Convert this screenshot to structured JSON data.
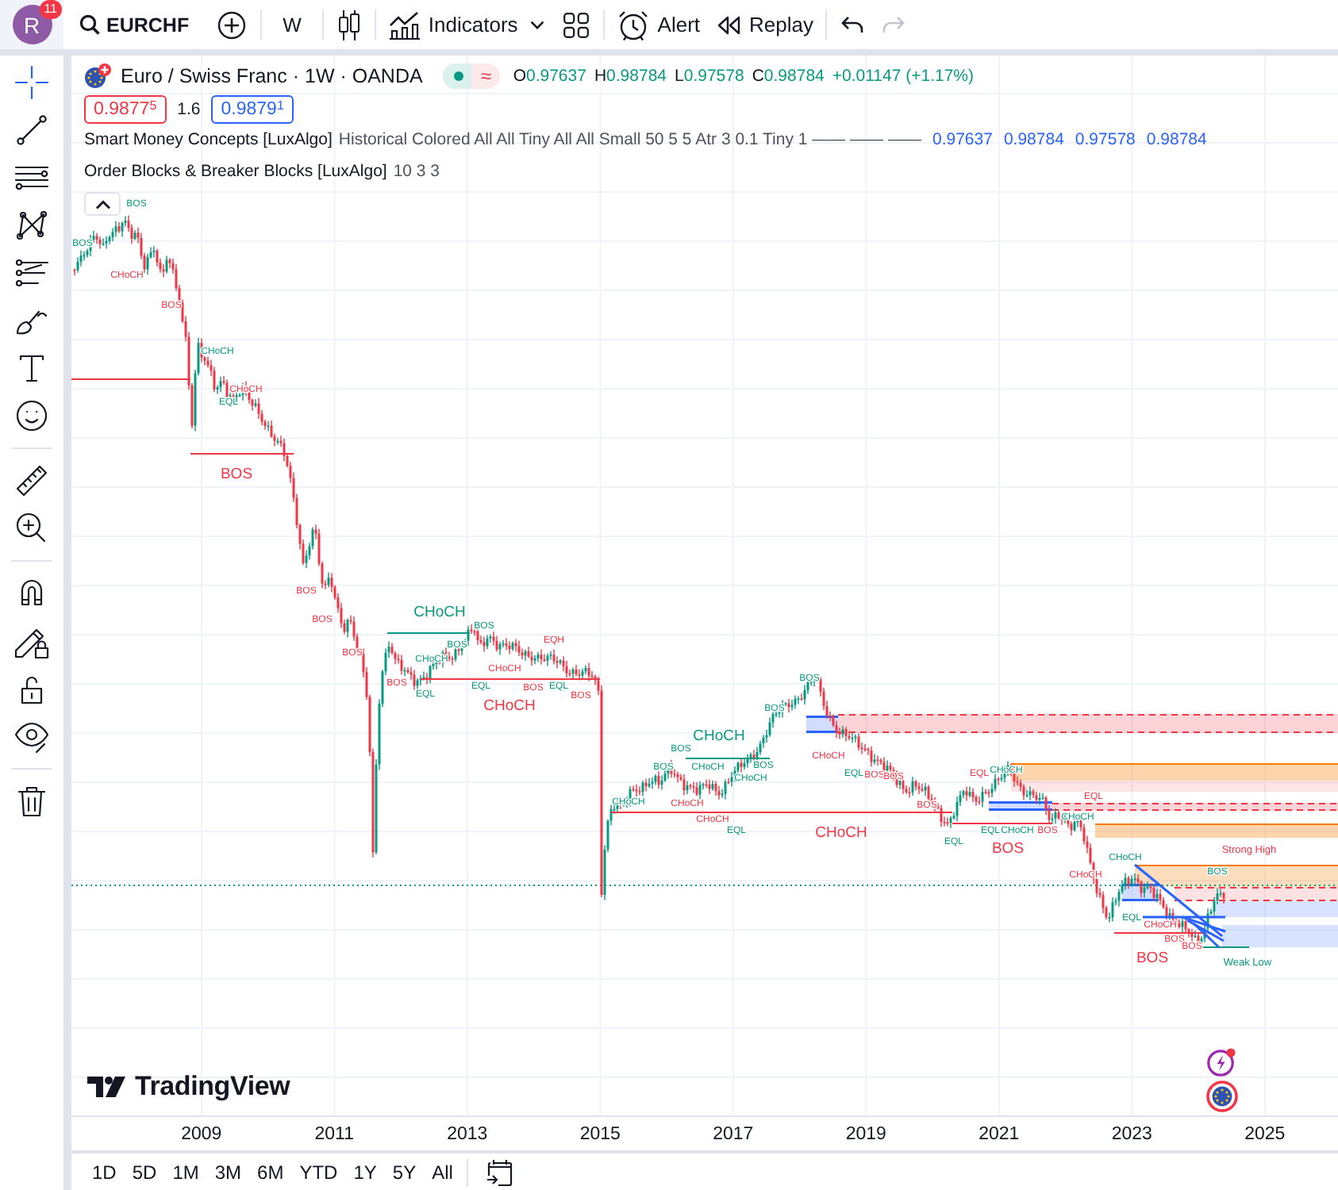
{
  "top_toolbar": {
    "avatar": {
      "initial": "R",
      "badge": "11"
    },
    "symbol": "EURCHF",
    "interval": "W",
    "indicators_button": "Indicators",
    "alert_button": "Alert",
    "replay_button": "Replay",
    "undo": {
      "disabled": false
    },
    "redo": {
      "disabled": true
    }
  },
  "drawing_toolbar": {
    "groups": [
      {
        "tools": [
          {
            "selected": true
          },
          {
            "selected": false
          },
          {
            "selected": false
          },
          {
            "selected": false
          },
          {
            "selected": false
          },
          {
            "selected": false
          },
          {
            "selected": false
          },
          {
            "selected": false
          }
        ]
      },
      {
        "tools": [
          {
            "selected": false
          },
          {
            "selected": false
          }
        ]
      },
      {
        "tools": [
          {
            "selected": false
          },
          {
            "selected": false
          },
          {
            "selected": false
          },
          {
            "selected": false
          }
        ]
      },
      {
        "tools": [
          {
            "selected": false
          }
        ]
      }
    ]
  },
  "legend": {
    "title": "Euro / Swiss Franc · 1W · OANDA",
    "market_badge": {
      "open": true,
      "symbol": "≈"
    },
    "ohlc": [
      {
        "label": "O",
        "value": "0.97637"
      },
      {
        "label": "H",
        "value": "0.98784"
      },
      {
        "label": "L",
        "value": "0.97578"
      },
      {
        "label": "C",
        "value": "0.98784"
      }
    ],
    "change": "+0.01147 (+1.17%)",
    "bid": "0.9877$^{5}$",
    "spread": "1.6",
    "ask": "0.9879$^{1}$"
  },
  "indicators": [
    {
      "name": "Smart Money Concepts [LuxAlgo]",
      "inputs": "Historical Colored All All Tiny All All Small 50 5 5 Atr 3 0.1 Tiny 1 —— —— ——",
      "values": [
        "0.97637",
        "0.98784",
        "0.97578",
        "0.98784"
      ]
    },
    {
      "name": "Order Blocks & Breaker Blocks [LuxAlgo]",
      "inputs": "10 3 3"
    }
  ],
  "chart": {
    "annotations": [
      {
        "text": "BOS",
        "color": "#089981",
        "kind": "internal"
      },
      {
        "text": "BOS",
        "color": "#089981",
        "kind": "internal"
      },
      {
        "text": "CHoCH",
        "color": "#f23645",
        "kind": "internal"
      },
      {
        "text": "BOS",
        "color": "#f23645",
        "kind": "internal"
      },
      {
        "text": "CHoCH",
        "color": "#089981",
        "kind": "internal"
      },
      {
        "text": "CHoCH",
        "color": "#f23645",
        "kind": "internal"
      },
      {
        "text": "EQL",
        "color": "#089981",
        "kind": "equal"
      },
      {
        "text": "BOS",
        "color": "#f23645",
        "kind": "swing"
      },
      {
        "text": "BOS",
        "color": "#f23645",
        "kind": "internal"
      },
      {
        "text": "BOS",
        "color": "#f23645",
        "kind": "internal"
      },
      {
        "text": "BOS",
        "color": "#f23645",
        "kind": "internal"
      },
      {
        "text": "CHoCH",
        "color": "#089981",
        "kind": "swing"
      },
      {
        "text": "BOS",
        "color": "#089981",
        "kind": "internal"
      },
      {
        "text": "EQH",
        "color": "#f23645",
        "kind": "equal"
      },
      {
        "text": "BOS",
        "color": "#089981",
        "kind": "internal"
      },
      {
        "text": "CHoCH",
        "color": "#089981",
        "kind": "internal"
      },
      {
        "text": "CHoCH",
        "color": "#f23645",
        "kind": "internal"
      },
      {
        "text": "BOS",
        "color": "#f23645",
        "kind": "internal"
      },
      {
        "text": "BOS",
        "color": "#f23645",
        "kind": "internal"
      },
      {
        "text": "EQL",
        "color": "#089981",
        "kind": "equal"
      },
      {
        "text": "EQL",
        "color": "#089981",
        "kind": "equal"
      },
      {
        "text": "BOS",
        "color": "#f23645",
        "kind": "internal"
      },
      {
        "text": "EQL",
        "color": "#089981",
        "kind": "equal"
      },
      {
        "text": "CHoCH",
        "color": "#f23645",
        "kind": "swing"
      },
      {
        "text": "CHoCH",
        "color": "#089981",
        "kind": "internal"
      },
      {
        "text": "CHoCH",
        "color": "#f23645",
        "kind": "internal"
      },
      {
        "text": "CHoCH",
        "color": "#f23645",
        "kind": "internal"
      },
      {
        "text": "EQL",
        "color": "#089981",
        "kind": "equal"
      },
      {
        "text": "BOS",
        "color": "#089981",
        "kind": "internal"
      },
      {
        "text": "BOS",
        "color": "#089981",
        "kind": "internal"
      },
      {
        "text": "CHoCH",
        "color": "#089981",
        "kind": "internal"
      },
      {
        "text": "CHoCH",
        "color": "#089981",
        "kind": "internal"
      },
      {
        "text": "BOS",
        "color": "#089981",
        "kind": "internal"
      },
      {
        "text": "CHoCH",
        "color": "#089981",
        "kind": "swing"
      },
      {
        "text": "BOS",
        "color": "#089981",
        "kind": "internal"
      },
      {
        "text": "BOS",
        "color": "#089981",
        "kind": "internal"
      },
      {
        "text": "CHoCH",
        "color": "#f23645",
        "kind": "internal"
      },
      {
        "text": "EQL",
        "color": "#089981",
        "kind": "equal"
      },
      {
        "text": "BOS",
        "color": "#f23645",
        "kind": "internal"
      },
      {
        "text": "BOS",
        "color": "#f23645",
        "kind": "internal"
      },
      {
        "text": "CHoCH",
        "color": "#f23645",
        "kind": "swing"
      },
      {
        "text": "BOS",
        "color": "#f23645",
        "kind": "internal"
      },
      {
        "text": "EQL",
        "color": "#089981",
        "kind": "equal"
      },
      {
        "text": "BOS",
        "color": "#f23645",
        "kind": "swing"
      },
      {
        "text": "EQL",
        "color": "#f23645",
        "kind": "equal"
      },
      {
        "text": "CHoCH",
        "color": "#089981",
        "kind": "internal"
      },
      {
        "text": "EQL",
        "color": "#089981",
        "kind": "equal"
      },
      {
        "text": "CHoCH",
        "color": "#089981",
        "kind": "internal"
      },
      {
        "text": "BOS",
        "color": "#f23645",
        "kind": "internal"
      },
      {
        "text": "EQL",
        "color": "#f23645",
        "kind": "equal"
      },
      {
        "text": "CHoCH",
        "color": "#089981",
        "kind": "internal"
      },
      {
        "text": "CHoCH",
        "color": "#f23645",
        "kind": "internal"
      },
      {
        "text": "Strong High",
        "color": "#f23645",
        "kind": "zone"
      },
      {
        "text": "CHoCH",
        "color": "#089981",
        "kind": "internal"
      },
      {
        "text": "BOS",
        "color": "#089981",
        "kind": "internal"
      },
      {
        "text": "EQL",
        "color": "#089981",
        "kind": "equal"
      },
      {
        "text": "CHoCH",
        "color": "#f23645",
        "kind": "internal"
      },
      {
        "text": "BOS",
        "color": "#f23645",
        "kind": "internal"
      },
      {
        "text": "BOS",
        "color": "#f23645",
        "kind": "swing"
      },
      {
        "text": "BOS",
        "color": "#f23645",
        "kind": "internal"
      },
      {
        "text": "Weak Low",
        "color": "#089981",
        "kind": "zone"
      }
    ]
  },
  "time_axis": {
    "labels": [
      "2009",
      "2011",
      "2013",
      "2015",
      "2017",
      "2019",
      "2021",
      "2023",
      "2025"
    ]
  },
  "logo": "TradingView",
  "range_bar": {
    "ranges": [
      {
        "label": "1D",
        "selected": false
      },
      {
        "label": "5D",
        "selected": false
      },
      {
        "label": "1M",
        "selected": false
      },
      {
        "label": "3M",
        "selected": false
      },
      {
        "label": "6M",
        "selected": false
      },
      {
        "label": "YTD",
        "selected": false
      },
      {
        "label": "1Y",
        "selected": false
      },
      {
        "label": "5Y",
        "selected": false
      },
      {
        "label": "All",
        "selected": false
      }
    ]
  }
}
